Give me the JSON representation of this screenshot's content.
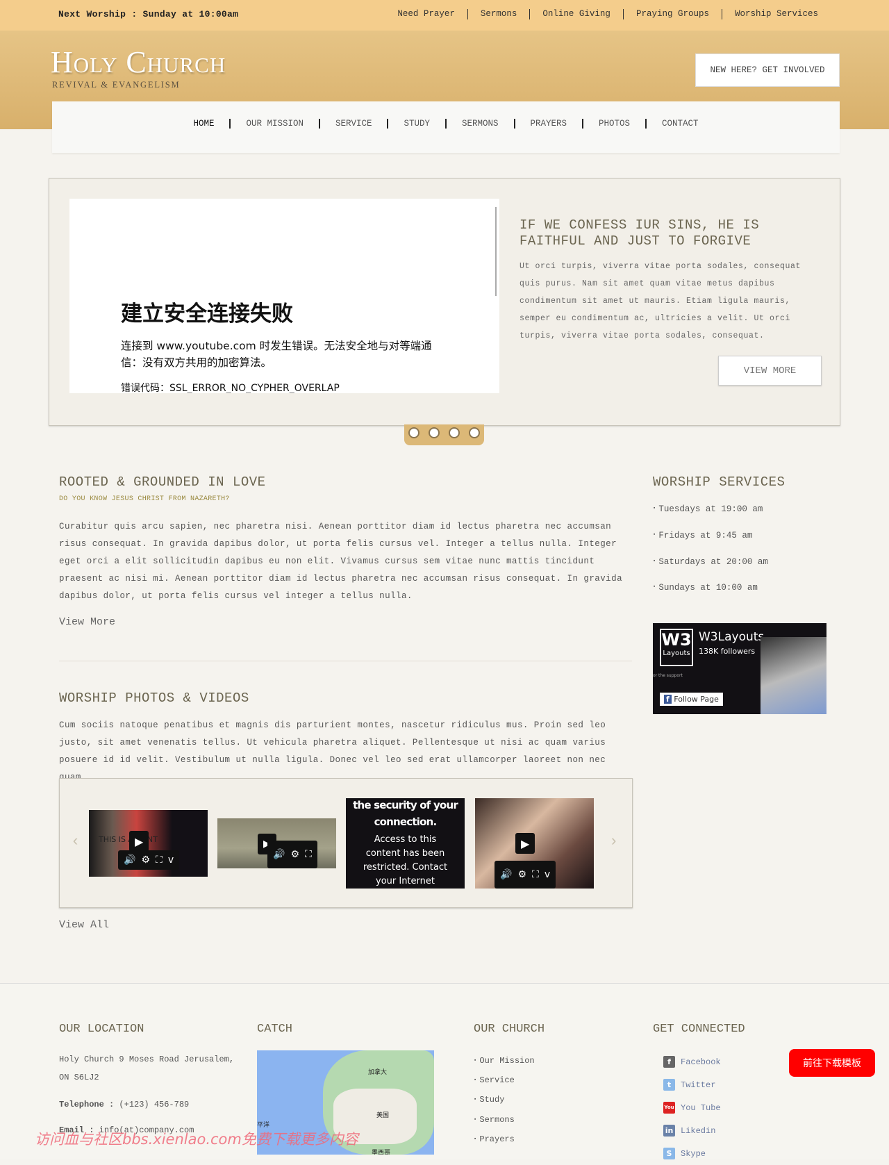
{
  "topbar": {
    "next_worship": "Next Worship : Sunday at 10:00am",
    "links": [
      "Need Prayer",
      "Sermons",
      "Online Giving",
      "Praying Groups",
      "Worship Services"
    ]
  },
  "header": {
    "logo": "Holy Church",
    "tagline": "REVIVAL & EVANGELISM",
    "cta": "NEW HERE? GET INVOLVED"
  },
  "nav": [
    "HOME",
    "OUR MISSION",
    "SERVICE",
    "STUDY",
    "SERMONS",
    "PRAYERS",
    "PHOTOS",
    "CONTACT"
  ],
  "slider": {
    "embed_error": {
      "title": "建立安全连接失败",
      "message": "连接到 www.youtube.com 时发生错误。无法安全地与对等端通信：没有双方共用的加密算法。",
      "code": "错误代码：SSL_ERROR_NO_CYPHER_OVERLAP"
    },
    "heading": "IF WE CONFESS IUR SINS, HE IS FAITHFUL AND JUST TO FORGIVE",
    "text": "Ut orci turpis, viverra vitae porta sodales, consequat quis purus. Nam sit amet quam vitae metus dapibus condimentum sit amet ut mauris. Etiam ligula mauris, semper eu condimentum ac, ultricies a velit. Ut orci turpis, viverra vitae porta sodales, consequat.",
    "button": "VIEW MORE",
    "active_dot": 1
  },
  "about": {
    "title": "ROOTED & GROUNDED IN LOVE",
    "subtitle": "DO YOU KNOW JESUS CHRIST FROM NAZARETH?",
    "text": "Curabitur quis arcu sapien, nec pharetra nisi. Aenean porttitor diam id lectus pharetra nec accumsan risus consequat. In gravida dapibus dolor, ut porta felis cursus vel. Integer a tellus nulla. Integer eget orci a elit sollicitudin dapibus eu non elit. Vivamus cursus sem vitae nunc mattis tincidunt praesent ac nisi mi. Aenean porttitor diam id lectus pharetra nec accumsan risus consequat. In gravida dapibus dolor, ut porta felis cursus vel integer a tellus nulla.",
    "link": "View More"
  },
  "media": {
    "title": "WORSHIP PHOTOS & VIDEOS",
    "text": "Cum sociis natoque penatibus et magnis dis parturient montes, nascetur ridiculus mus. Proin sed leo justo, sit amet venenatis tellus. Ut vehicula pharetra aliquet. Pellentesque ut nisi ac quam varius posuere id id velit. Vestibulum ut nulla ligula. Donec vel leo sed erat ullamcorper laoreet non nec quam.",
    "video1_overlay": "THIS IS A MENT",
    "video3_text": {
      "title": "the security of your connection.",
      "body": "Access to this content has been restricted. Contact your Internet service"
    },
    "link": "View All"
  },
  "services": {
    "title": "WORSHIP SERVICES",
    "items": [
      "Tuesdays at 19:00 am",
      "Fridays at 9:45 am",
      "Saturdays at 20:00 am",
      "Sundays at 10:00 am"
    ]
  },
  "facebook": {
    "logo_big": "W3",
    "logo_small": "Layouts",
    "name": "W3Layouts",
    "followers": "138K followers",
    "support": "or the support",
    "follow": "Follow Page"
  },
  "footer": {
    "location": {
      "title": "OUR LOCATION",
      "address": "Holy Church 9 Moses Road Jerusalem, ON S6LJ2",
      "tel_label": "Telephone :",
      "tel": "(+123) 456-789",
      "email_label": "Email :",
      "email": "info(at)company.com"
    },
    "catch": {
      "title": "CATCH",
      "map_labels": [
        "加拿大",
        "美国",
        "平洋",
        "墨西哥"
      ]
    },
    "church": {
      "title": "OUR CHURCH",
      "items": [
        "Our Mission",
        "Service",
        "Study",
        "Sermons",
        "Prayers"
      ]
    },
    "connected": {
      "title": "GET CONNECTED",
      "items": [
        "Facebook",
        "Twitter",
        "You Tube",
        "Likedin",
        "Skype"
      ]
    }
  },
  "download_button": "前往下载模板",
  "watermark": "访问血与社区bbs.xienlao.com免费下载更多内容",
  "colors": {
    "topbar": "#f4cd8c",
    "header": "#d8b06b",
    "download": "#ff0000"
  }
}
